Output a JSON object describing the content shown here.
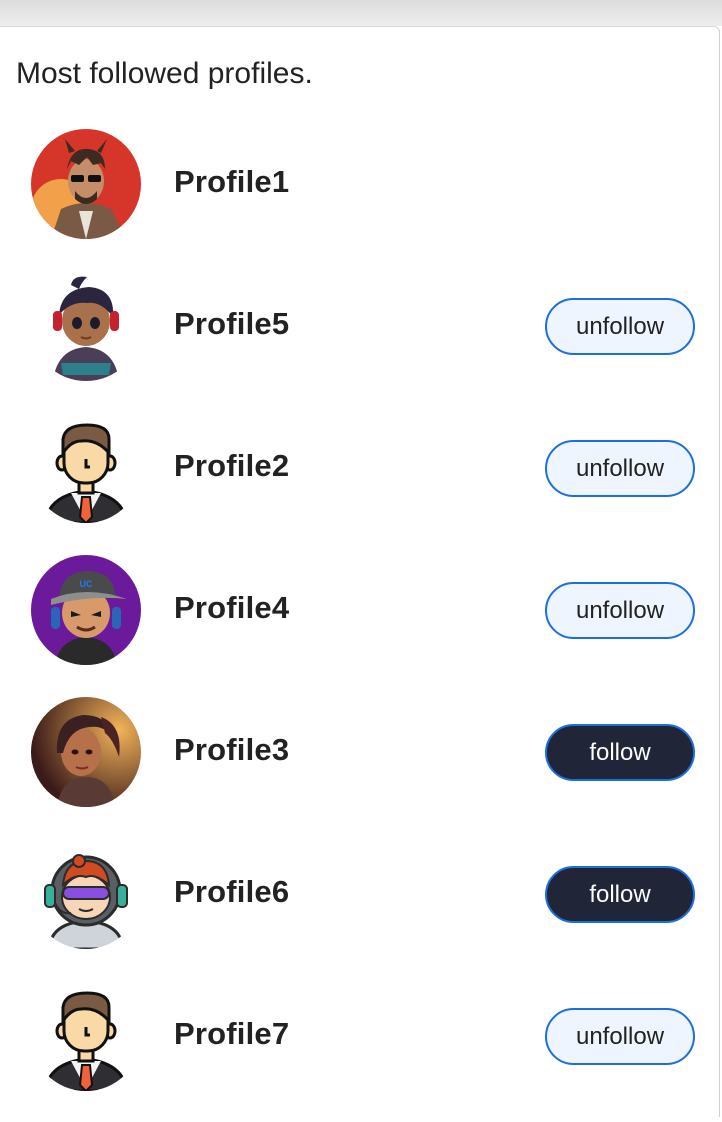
{
  "heading": "Most followed profiles.",
  "profiles": [
    {
      "name": "Profile1",
      "avatar_icon": "bearded-man-sunglasses-avatar-icon",
      "button": null
    },
    {
      "name": "Profile5",
      "avatar_icon": "gamer-girl-headphones-avatar-icon",
      "button": "unfollow"
    },
    {
      "name": "Profile2",
      "avatar_icon": "businessman-avatar-icon",
      "button": "unfollow"
    },
    {
      "name": "Profile4",
      "avatar_icon": "gamer-cap-purple-avatar-icon",
      "button": "unfollow"
    },
    {
      "name": "Profile3",
      "avatar_icon": "warrior-woman-avatar-icon",
      "button": "follow"
    },
    {
      "name": "Profile6",
      "avatar_icon": "astronaut-girl-headset-avatar-icon",
      "button": "follow"
    },
    {
      "name": "Profile7",
      "avatar_icon": "businessman-avatar-icon",
      "button": "unfollow"
    }
  ],
  "colors": {
    "follow_bg": "#212538",
    "unfollow_bg": "#eef5ff",
    "button_border": "#1b6fe0"
  }
}
